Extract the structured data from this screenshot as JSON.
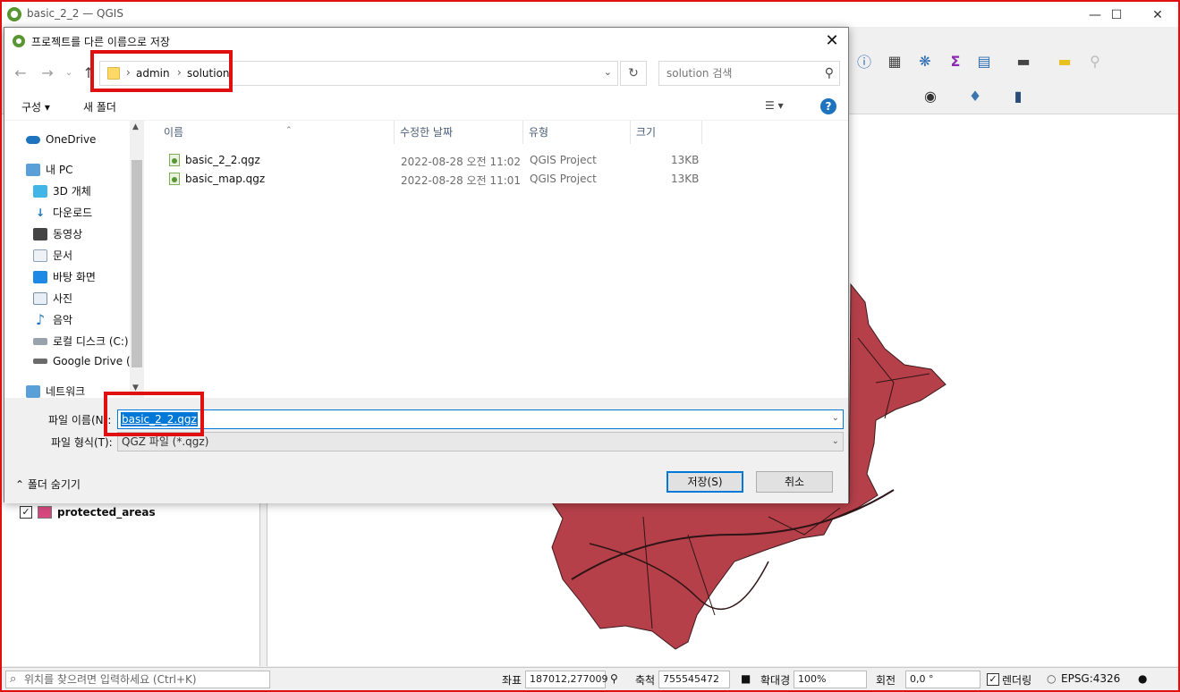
{
  "qgis": {
    "window_title": "basic_2_2 — QGIS",
    "layers": [
      {
        "label": "protected_areas",
        "checked": true,
        "color": "#d6487e"
      }
    ],
    "statusbar": {
      "locate_placeholder": "위치를 찾으려면 입력하세요 (Ctrl+K)",
      "coord_label": "좌표",
      "coord_value": "187012,277009",
      "scale_label": "축척",
      "scale_value": "755545472",
      "magnifier_label": "확대경",
      "magnifier_value": "100%",
      "rotation_label": "회전",
      "rotation_value": "0,0 °",
      "render_label": "렌더링",
      "crs": "EPSG:4326"
    },
    "map_fill_color": "#b5404a"
  },
  "dialog": {
    "title": "프로젝트를 다른 이름으로 저장",
    "breadcrumb": [
      "admin",
      "solution"
    ],
    "search_placeholder": "solution 검색",
    "organize_label": "구성 ▾",
    "new_folder_label": "새 폴더",
    "nav_items": [
      {
        "label": "OneDrive",
        "icon": "cloud-icon"
      },
      {
        "label": "내 PC",
        "icon": "pc-icon"
      },
      {
        "label": "3D 개체",
        "icon": "cube-icon"
      },
      {
        "label": "다운로드",
        "icon": "download-icon"
      },
      {
        "label": "동영상",
        "icon": "video-icon"
      },
      {
        "label": "문서",
        "icon": "document-icon"
      },
      {
        "label": "바탕 화면",
        "icon": "desktop-icon"
      },
      {
        "label": "사진",
        "icon": "picture-icon"
      },
      {
        "label": "음악",
        "icon": "music-icon"
      },
      {
        "label": "로컬 디스크 (C:)",
        "icon": "drive-icon"
      },
      {
        "label": "Google Drive (G",
        "icon": "drive-icon"
      },
      {
        "label": "네트워크",
        "icon": "network-icon"
      }
    ],
    "columns": [
      "이름",
      "수정한 날짜",
      "유형",
      "크기"
    ],
    "files": [
      {
        "name": "basic_2_2.qgz",
        "date": "2022-08-28 오전 11:02",
        "type": "QGIS Project",
        "size": "13KB"
      },
      {
        "name": "basic_map.qgz",
        "date": "2022-08-28 오전 11:01",
        "type": "QGIS Project",
        "size": "13KB"
      }
    ],
    "filename_label": "파일 이름(N):",
    "filename_value": "basic_2_2.qgz",
    "filetype_label": "파일 형식(T):",
    "filetype_value": "QGZ 파일 (*.qgz)",
    "hide_folders_label": "폴더 숨기기",
    "save_label": "저장(S)",
    "cancel_label": "취소"
  }
}
